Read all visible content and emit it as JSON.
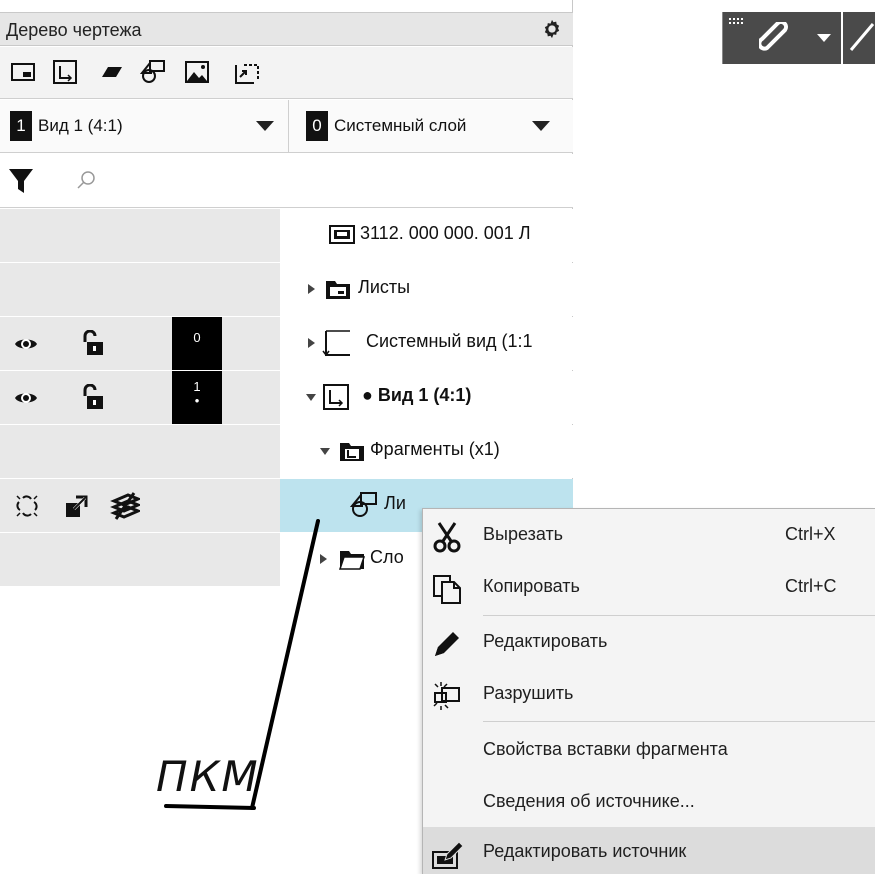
{
  "panel": {
    "title": "Дерево чертежа",
    "icons": [
      "view-rect-icon",
      "view-axes-icon",
      "parallelogram-icon",
      "fragment-icon",
      "image-icon",
      "insert-view-icon"
    ]
  },
  "selectors": {
    "view": {
      "num": "1",
      "text": "Вид 1 (4:1)"
    },
    "layer": {
      "num": "0",
      "text": "Системный слой"
    }
  },
  "search": {
    "placeholder": ""
  },
  "tree": {
    "rows": [
      {
        "label": "3112. 000 000. 001 Л"
      },
      {
        "label": "Листы"
      },
      {
        "label": "Системный вид (1:1",
        "num": "0"
      },
      {
        "label": "● Вид 1 (4:1)",
        "num": "1",
        "dot": "•"
      },
      {
        "label": "Фрагменты (х1)"
      },
      {
        "label": "Ли",
        "hidden_suffix": ""
      },
      {
        "label": "Сло"
      }
    ]
  },
  "context_menu": {
    "items": [
      {
        "label": "Вырезать",
        "shortcut": "Ctrl+X",
        "icon": "scissors-icon"
      },
      {
        "label": "Копировать",
        "shortcut": "Ctrl+C",
        "icon": "copy-icon"
      },
      {
        "label": "Редактировать",
        "icon": "pencil-icon"
      },
      {
        "label": "Разрушить",
        "icon": "explode-icon"
      },
      {
        "label": "Свойства вставки фрагмента"
      },
      {
        "label": "Сведения об источнике..."
      },
      {
        "label": "Редактировать источник",
        "icon": "edit-source-icon"
      }
    ]
  },
  "annotation": {
    "text": "ПКМ"
  },
  "colors": {
    "selected_row": "#bde3ee",
    "left_col": "#e8e8e8",
    "menu_bg": "#f4f4f4",
    "hover": "#dcdcdc"
  }
}
